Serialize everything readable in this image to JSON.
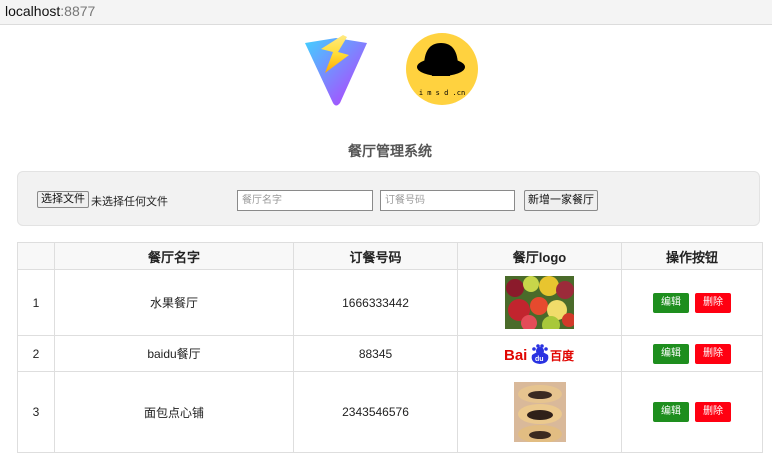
{
  "browser": {
    "host": "localhost",
    "port": ":8877"
  },
  "header": {
    "lady_logo_text": "i m s d .cn"
  },
  "page": {
    "title": "餐厅管理系统"
  },
  "form": {
    "file_button": "选择文件",
    "file_status": "未选择任何文件",
    "name_placeholder": "餐厅名字",
    "phone_placeholder": "订餐号码",
    "add_button": "新增一家餐厅"
  },
  "table": {
    "headers": [
      "",
      "餐厅名字",
      "订餐号码",
      "餐厅logo",
      "操作按钮"
    ],
    "rows": [
      {
        "index": "1",
        "name": "水果餐厅",
        "phone": "1666333442",
        "logo": "fruit-photo",
        "edit": "编辑",
        "delete": "删除"
      },
      {
        "index": "2",
        "name": "baidu餐厅",
        "phone": "88345",
        "logo": "baidu-logo",
        "logo_text_a": "Bai",
        "logo_text_b": "du",
        "logo_text_c": "百度",
        "edit": "编辑",
        "delete": "删除"
      },
      {
        "index": "3",
        "name": "面包点心铺",
        "phone": "2343546576",
        "logo": "pastry-photo",
        "edit": "编辑",
        "delete": "删除"
      }
    ]
  },
  "colors": {
    "edit_button": "#1e8e1e",
    "delete_button": "#ff0011",
    "baidu_red": "#e10602",
    "baidu_blue": "#2932e1"
  }
}
